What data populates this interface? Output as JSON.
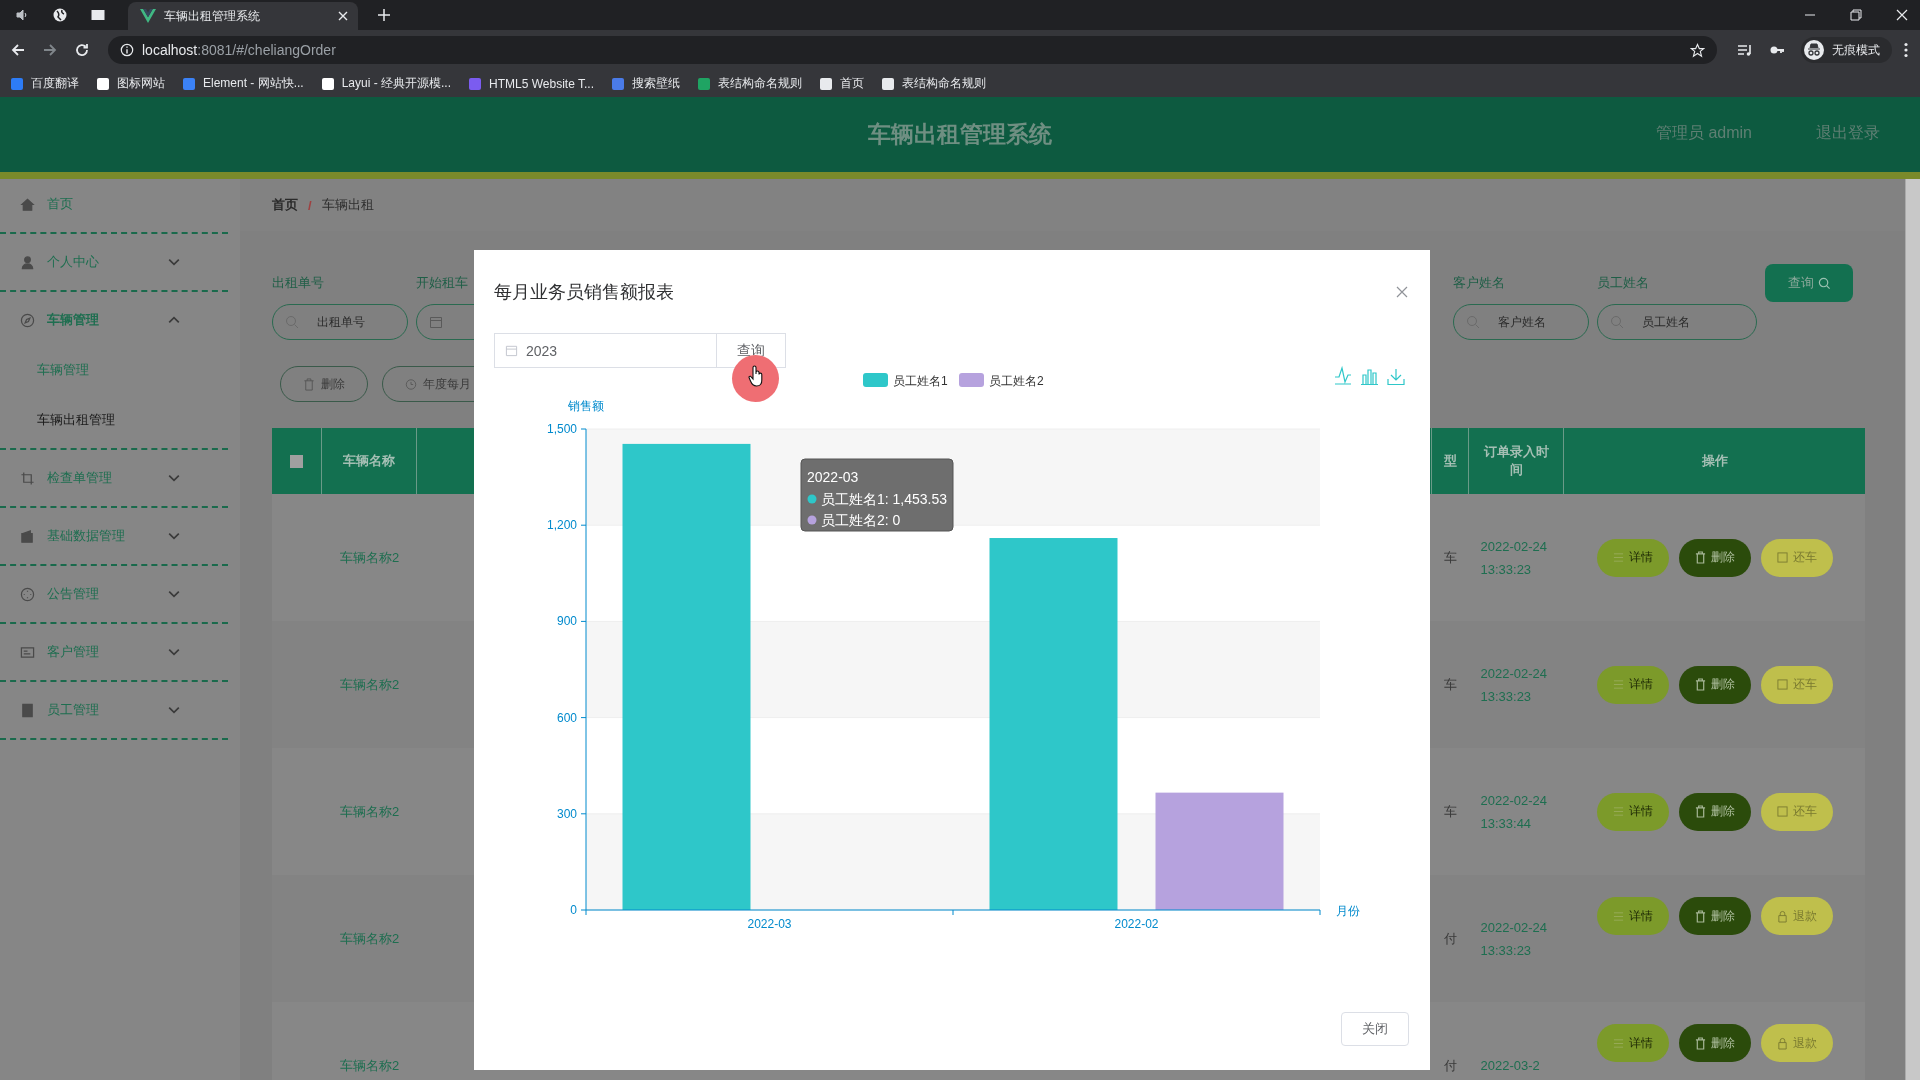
{
  "browser": {
    "tab_title": "车辆出租管理系统",
    "url_host": "localhost",
    "url_rest": ":8081/#/cheliangOrder",
    "profile": "无痕模式",
    "bookmarks": [
      "百度翻译",
      "图标网站",
      "Element - 网站快...",
      "Layui - 经典开源模...",
      "HTML5 Website T...",
      "搜索壁纸",
      "表结构命名规则",
      "首页",
      "表结构命名规则"
    ]
  },
  "header": {
    "title": "车辆出租管理系统",
    "user": "管理员 admin",
    "logout": "退出登录"
  },
  "sidebar": {
    "items": [
      {
        "label": "首页",
        "kind": "link"
      },
      {
        "label": "个人中心",
        "kind": "submenu",
        "expanded": false
      },
      {
        "label": "车辆管理",
        "kind": "submenu",
        "expanded": true,
        "children": [
          {
            "label": "车辆管理",
            "selected": false
          },
          {
            "label": "车辆出租管理",
            "selected": true
          }
        ]
      },
      {
        "label": "检查单管理",
        "kind": "submenu",
        "expanded": false
      },
      {
        "label": "基础数据管理",
        "kind": "submenu",
        "expanded": false
      },
      {
        "label": "公告管理",
        "kind": "submenu",
        "expanded": false
      },
      {
        "label": "客户管理",
        "kind": "submenu",
        "expanded": false
      },
      {
        "label": "员工管理",
        "kind": "submenu",
        "expanded": false
      }
    ]
  },
  "breadcrumb": {
    "items": [
      "首页",
      "车辆出租"
    ],
    "separator": "/"
  },
  "search": {
    "left_fields": [
      {
        "label": "出租单号",
        "placeholder": "出租单号",
        "kind": "text"
      },
      {
        "label": "开始租车",
        "kind": "date"
      }
    ],
    "right_fields": [
      {
        "label": "客户姓名",
        "placeholder": "客户姓名",
        "kind": "text"
      },
      {
        "label": "员工姓名",
        "placeholder": "员工姓名",
        "kind": "text"
      }
    ],
    "button": "查询"
  },
  "actions": [
    {
      "label": "删除",
      "kind": "delete"
    },
    {
      "label": "年度每月",
      "kind": "report"
    }
  ],
  "table": {
    "select_all": {
      "checked": false
    },
    "columns": [
      "车辆名称",
      "型",
      "订单录入时间",
      "操作"
    ],
    "rows": [
      {
        "name": "车辆名称2",
        "column_type": "车",
        "time": "2022-02-24 13:33:23",
        "buttons": [
          {
            "label": "详情",
            "kind": "detail"
          },
          {
            "label": "删除",
            "kind": "delete"
          },
          {
            "label": "还车",
            "kind": "return"
          }
        ]
      },
      {
        "name": "车辆名称2",
        "column_type": "车",
        "time": "2022-02-24 13:33:23",
        "buttons": [
          {
            "label": "详情",
            "kind": "detail"
          },
          {
            "label": "删除",
            "kind": "delete"
          },
          {
            "label": "还车",
            "kind": "return"
          }
        ]
      },
      {
        "name": "车辆名称2",
        "column_type": "车",
        "time": "2022-02-24 13:33:44",
        "buttons": [
          {
            "label": "详情",
            "kind": "detail"
          },
          {
            "label": "删除",
            "kind": "delete"
          },
          {
            "label": "还车",
            "kind": "return"
          }
        ]
      },
      {
        "name": "车辆名称2",
        "column_type": "付",
        "time": "2022-02-24 13:33:23",
        "buttons": [
          {
            "label": "详情",
            "kind": "detail"
          },
          {
            "label": "删除",
            "kind": "delete"
          },
          {
            "label": "退款",
            "kind": "refund"
          }
        ]
      },
      {
        "name": "车辆名称2",
        "column_type": "付",
        "time": "2022-03-2",
        "buttons": [
          {
            "label": "详情",
            "kind": "detail"
          },
          {
            "label": "删除",
            "kind": "delete"
          },
          {
            "label": "退款",
            "kind": "refund"
          }
        ]
      }
    ]
  },
  "modal": {
    "title": "每月业务员销售额报表",
    "year": "2023",
    "query": "查询",
    "close": "关闭",
    "tooltip": {
      "title": "2022-03",
      "lines": [
        "员工姓名1: 1,453.53",
        "员工姓名2: 0"
      ]
    },
    "chart": {
      "chart_data": {
        "type": "bar",
        "xlabel": "月份",
        "ylabel": "销售额",
        "categories": [
          "2022-03",
          "2022-02"
        ],
        "series": [
          {
            "name": "员工姓名1",
            "color": "#2ec7c9",
            "values": [
              1453.53,
              1160
            ]
          },
          {
            "name": "员工姓名2",
            "color": "#b6a2de",
            "values": [
              0,
              366
            ]
          }
        ],
        "ylim": [
          0,
          1500
        ],
        "grid": true,
        "legend": true,
        "yticks": [
          {
            "value": 0,
            "label": "0"
          },
          {
            "value": 300,
            "label": "300"
          },
          {
            "value": 600,
            "label": "600"
          },
          {
            "value": 900,
            "label": "900"
          },
          {
            "value": 1200,
            "label": "1,200"
          },
          {
            "value": 1500,
            "label": "1,500"
          }
        ]
      }
    }
  }
}
